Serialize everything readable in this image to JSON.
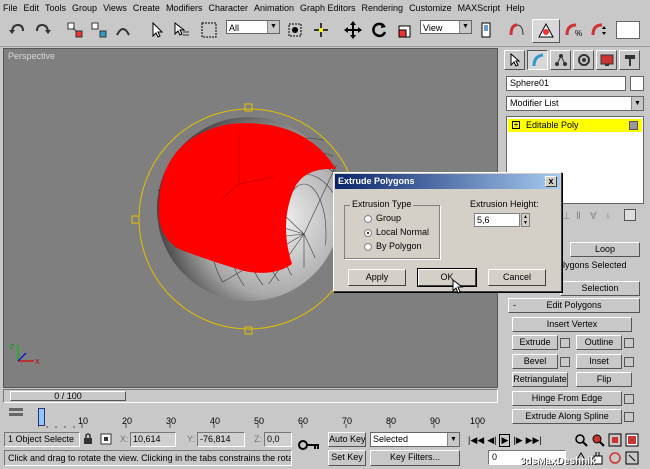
{
  "menu": [
    "File",
    "Edit",
    "Tools",
    "Group",
    "Views",
    "Create",
    "Modifiers",
    "Character",
    "Animation",
    "Graph Editors",
    "Rendering",
    "Customize",
    "MAXScript",
    "Help"
  ],
  "toolbar": {
    "selection_filter": "All",
    "reference_coord": "View"
  },
  "viewport": {
    "label": "Perspective",
    "sphere_color": "#ff0000",
    "gizmo_color": "#e0c000"
  },
  "command_panel": {
    "object_name": "Sphere01",
    "modifier_list": "Modifier List",
    "stack_item": "Editable Poly",
    "stack_highlight": "#ffff00",
    "loop_label": "Loop",
    "polygons_selected": "olygons Selected",
    "selection_label": "Selection",
    "rollout_title": "Edit Polygons",
    "rollout_toggle": "-",
    "buttons": {
      "insert_vertex": "Insert Vertex",
      "extrude": "Extrude",
      "outline": "Outline",
      "bevel": "Bevel",
      "inset": "Inset",
      "retriangulate": "Retriangulate",
      "flip": "Flip",
      "hinge": "Hinge From Edge",
      "extrude_spline": "Extrude Along Spline"
    }
  },
  "dialog": {
    "title": "Extrude Polygons",
    "close": "x",
    "group_title": "Extrusion Type",
    "options": [
      "Group",
      "Local Normal",
      "By Polygon"
    ],
    "selected_option": "Local Normal",
    "height_label": "Extrusion Height:",
    "height_value": "5,6",
    "apply": "Apply",
    "ok": "OK",
    "cancel": "Cancel"
  },
  "timeline": {
    "frame": "0 / 100",
    "ticks": [
      "0",
      "10",
      "20",
      "30",
      "40",
      "50",
      "60",
      "70",
      "80",
      "90",
      "100"
    ]
  },
  "status": {
    "selection": "1 Object Selecte",
    "x_label": "X:",
    "x_value": "10,614",
    "y_label": "Y:",
    "y_value": "-76,814",
    "z_label": "Z:",
    "z_value": "0,0",
    "auto_key": "Auto Key",
    "selected": "Selected",
    "set_key": "Set Key",
    "key_filters": "Key Filters...",
    "current_frame": "0",
    "prompt": "Click and drag to rotate the view.  Clicking in the tabs constrains the rotat",
    "watermark": "3dsMaxDeshnik"
  }
}
